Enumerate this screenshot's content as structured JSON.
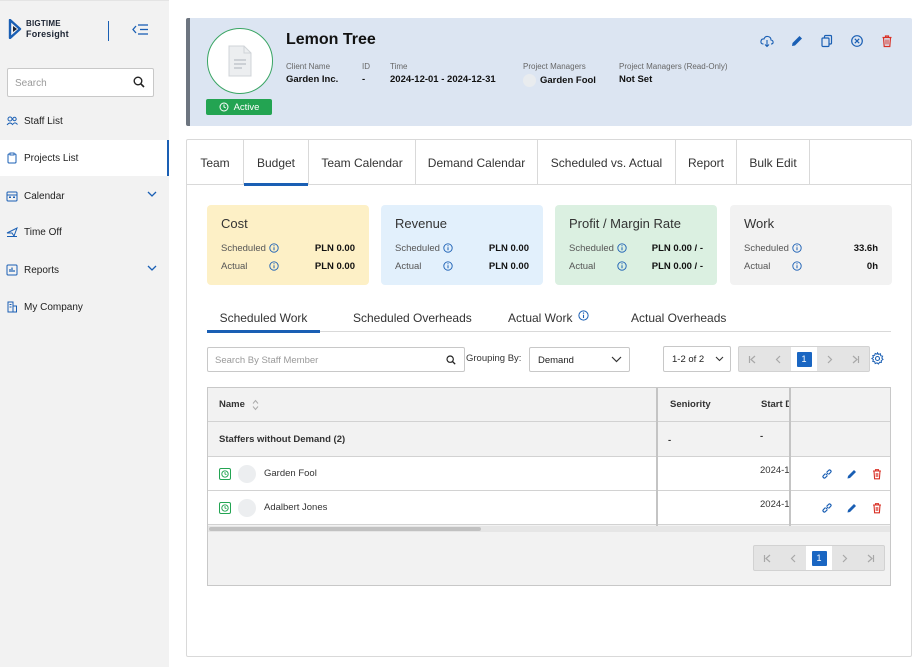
{
  "brand": {
    "line1": "BIGTIME",
    "line2": "Foresight"
  },
  "sidebar": {
    "search_placeholder": "Search",
    "items": [
      {
        "label": "Staff List",
        "icon": "users-icon"
      },
      {
        "label": "Projects List",
        "icon": "clipboard-icon",
        "active": true
      },
      {
        "label": "Calendar",
        "icon": "calendar-icon",
        "expandable": true
      },
      {
        "label": "Time Off",
        "icon": "plane-icon"
      },
      {
        "label": "Reports",
        "icon": "chart-icon",
        "expandable": true
      },
      {
        "label": "My Company",
        "icon": "building-icon"
      }
    ]
  },
  "project": {
    "title": "Lemon Tree",
    "status": "Active",
    "meta": [
      {
        "label": "Client Name",
        "value": "Garden Inc."
      },
      {
        "label": "ID",
        "value": "-"
      },
      {
        "label": "Time",
        "value": "2024-12-01 - 2024-12-31"
      },
      {
        "label": "Project Managers",
        "value": "Garden Fool"
      },
      {
        "label": "Project Managers (Read-Only)",
        "value": "Not Set"
      }
    ]
  },
  "tabs": [
    "Team",
    "Budget",
    "Team Calendar",
    "Demand Calendar",
    "Scheduled vs. Actual",
    "Report",
    "Bulk Edit"
  ],
  "active_tab": "Budget",
  "kpis": [
    {
      "title": "Cost",
      "color": "#fdf0c6",
      "scheduled": "PLN 0.00",
      "actual": "PLN 0.00"
    },
    {
      "title": "Revenue",
      "color": "#e2f0fc",
      "scheduled": "PLN 0.00",
      "actual": "PLN 0.00"
    },
    {
      "title": "Profit / Margin Rate",
      "color": "#dbf0e1",
      "scheduled": "PLN 0.00 / -",
      "actual": "PLN 0.00 / -"
    },
    {
      "title": "Work",
      "color": "#f2f2f2",
      "scheduled": "33.6h",
      "actual": "0h"
    }
  ],
  "kpi_labels": {
    "scheduled": "Scheduled",
    "actual": "Actual"
  },
  "subtabs": [
    "Scheduled Work",
    "Scheduled Overheads",
    "Actual Work",
    "Actual Overheads"
  ],
  "toolbar": {
    "search_placeholder": "Search By Staff Member",
    "grouping_label": "Grouping By:",
    "grouping_value": "Demand",
    "range": "1-2 of 2",
    "page": "1"
  },
  "grid": {
    "columns": {
      "name": "Name",
      "seniority": "Seniority",
      "start": "Start D"
    },
    "group": {
      "label": "Staffers without Demand (2)",
      "seniority": "-",
      "start": "-"
    },
    "rows": [
      {
        "name": "Garden Fool",
        "seniority": "",
        "start": "2024-1"
      },
      {
        "name": "Adalbert Jones",
        "seniority": "",
        "start": "2024-1"
      }
    ]
  },
  "colors": {
    "accent": "#1a5fb4",
    "active": "#23a452",
    "delete": "#d93025"
  }
}
